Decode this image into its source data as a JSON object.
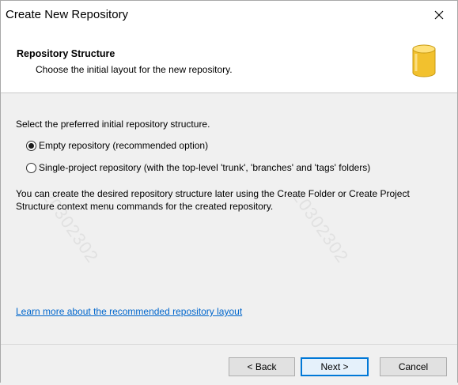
{
  "window": {
    "title": "Create New Repository"
  },
  "header": {
    "title": "Repository Structure",
    "subtitle": "Choose the initial layout for the new repository."
  },
  "body": {
    "prompt": "Select the preferred initial repository structure.",
    "options": [
      {
        "label": "Empty repository (recommended option)",
        "checked": true
      },
      {
        "label": "Single-project repository (with the top-level 'trunk', 'branches' and 'tags' folders)",
        "checked": false
      }
    ],
    "info": "You can create the desired repository structure later using the Create Folder or Create Project Structure context menu commands for the created repository.",
    "learn_more": "Learn more about the recommended repository layout",
    "watermark": "20302302"
  },
  "buttons": {
    "back": "< Back",
    "next": "Next >",
    "cancel": "Cancel"
  },
  "icons": {
    "header_icon": "database-icon",
    "close_icon": "close-icon"
  },
  "colors": {
    "link": "#0066cc",
    "icon": "#f2c12e",
    "primary_border": "#0078d7"
  }
}
